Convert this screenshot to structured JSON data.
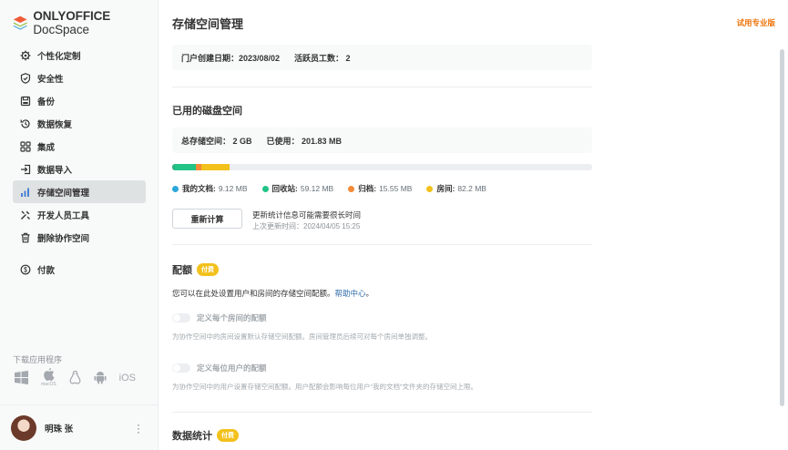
{
  "app": {
    "logo_bold": "ONLYOFFICE",
    "logo_light": " DocSpace"
  },
  "sidebar": {
    "items": [
      {
        "label": "个性化定制",
        "icon": "gear-icon"
      },
      {
        "label": "安全性",
        "icon": "shield-icon"
      },
      {
        "label": "备份",
        "icon": "backup-icon"
      },
      {
        "label": "数据恢复",
        "icon": "restore-icon"
      },
      {
        "label": "集成",
        "icon": "grid-icon"
      },
      {
        "label": "数据导入",
        "icon": "import-icon"
      },
      {
        "label": "存储空间管理",
        "icon": "bar-chart-icon",
        "active": true
      },
      {
        "label": "开发人员工具",
        "icon": "tools-icon"
      },
      {
        "label": "删除协作空间",
        "icon": "trash-icon"
      },
      {
        "label": "付款",
        "icon": "payment-icon"
      }
    ],
    "download_title": "下载应用程序",
    "download_apps": {
      "macos_label": "macOS",
      "ios_label": "iOS"
    },
    "user_name": "明珠 张"
  },
  "main": {
    "title": "存储空间管理",
    "trial_link": "试用专业版",
    "portal_created_label": "门户创建日期：2023/08/02",
    "active_users_label": "活跃员工数： 2",
    "disk_section_title": "已用的磁盘空间",
    "total_storage_label": "总存储空间： 2 GB",
    "used_label": "已使用： 201.83 MB",
    "usage": {
      "total_mb": 2048,
      "segments": [
        {
          "name": "我的文档:",
          "value": "9.12 MB",
          "mb": 9.12,
          "color": "#2db482"
        },
        {
          "name": "回收站:",
          "value": "59.12 MB",
          "mb": 59.12,
          "color": "#22c386"
        },
        {
          "name": "归档:",
          "value": "15.55 MB",
          "mb": 15.55,
          "color": "#f48a37"
        },
        {
          "name": "房间:",
          "value": "82.2 MB",
          "mb": 82.2,
          "color": "#f2c11c"
        }
      ],
      "legend_colors": [
        "#2da7db",
        "#22c386",
        "#f48a37",
        "#f2c11c"
      ]
    },
    "recalc_button": "重新计算",
    "recalc_note": "更新统计信息可能需要很长时间",
    "recalc_time": "上次更新时间：2024/04/05 15:25",
    "quota_title": "配额",
    "paid_badge": "付费",
    "quota_desc": "您可以在此处设置用户和房间的存储空间配额。",
    "help_link": "帮助中心",
    "help_suffix": "。",
    "room_quota_label": "定义每个房间的配额",
    "room_quota_desc": "为协作空间中的房间设置默认存储空间配额。房间管理员后续可对每个房间单独调整。",
    "user_quota_label": "定义每位用户的配额",
    "user_quota_desc": "为协作空间中的用户设置存储空间配额。用户配额会影响每位用户“我的文档”文件夹的存储空间上限。",
    "stats_title": "数据统计",
    "stats_badge": "付费"
  }
}
